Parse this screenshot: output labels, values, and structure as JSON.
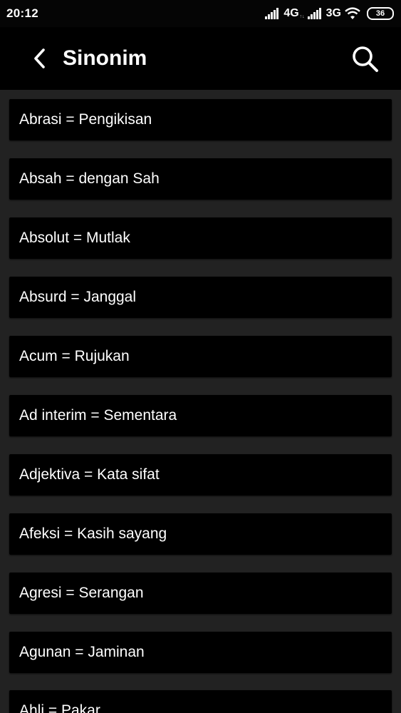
{
  "status_bar": {
    "time": "20:12",
    "network_1": "4G",
    "network_1_sub": "↑↓",
    "network_2": "3G",
    "battery": "36"
  },
  "app_bar": {
    "title": "Sinonim",
    "back_icon": "chevron-left-icon",
    "search_icon": "search-icon"
  },
  "colors": {
    "background": "#222222",
    "app_bar": "#000000",
    "card": "#000000",
    "text": "#ffffff"
  },
  "items": [
    "Abrasi = Pengikisan",
    "Absah = dengan Sah",
    "Absolut = Mutlak",
    "Absurd = Janggal",
    "Acum = Rujukan",
    "Ad interim = Sementara",
    "Adjektiva = Kata sifat",
    "Afeksi = Kasih sayang",
    "Agresi = Serangan",
    "Agunan = Jaminan",
    "Ahli = Pakar"
  ]
}
